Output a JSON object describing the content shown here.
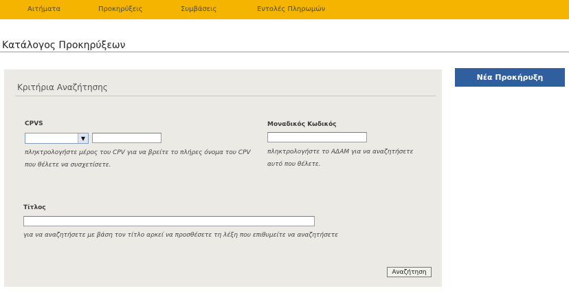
{
  "nav": {
    "items": [
      {
        "label": "Αιτήματα"
      },
      {
        "label": "Προκηρύξεις"
      },
      {
        "label": "Συμβάσεις"
      },
      {
        "label": "Εντολές Πληρωμών"
      }
    ]
  },
  "page": {
    "title": "Κατάλογος Προκηρύξεων"
  },
  "search": {
    "heading": "Κριτήρια Αναζήτησης",
    "cpvs": {
      "label": "CPVS",
      "select_value": "",
      "text_value": "",
      "hint": "πληκτρολογήστε μέρος του CPV για να βρείτε το πλήρες όνομα του CPV που θέλετε να συσχετίσετε."
    },
    "unique_code": {
      "label": "Μοναδικός Κωδικός",
      "value": "",
      "hint": "πληκτρολογήστε το ΑΔΑΜ για να αναζητήσετε αυτό που θέλετε."
    },
    "title_field": {
      "label": "Τίτλος",
      "value": "",
      "hint": "για να αναζητήσετε με βάση τον τίτλο αρκεί να προσθέσετε τη λέξη που επιθυμείτε να αναζητήσετε"
    },
    "submit_label": "Αναζήτηση"
  },
  "actions": {
    "new_label": "Νέα Προκήρυξη"
  },
  "colors": {
    "nav_bar": "#f5b400",
    "panel_bg": "#ebeae5",
    "primary_button": "#2f5f9e"
  }
}
